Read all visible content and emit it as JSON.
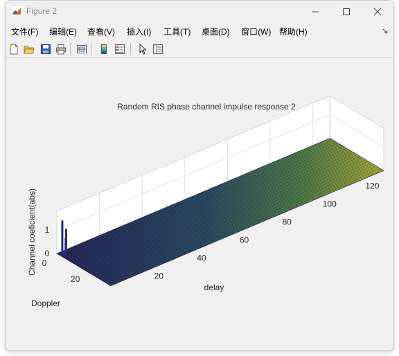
{
  "window": {
    "title": "Figure 2"
  },
  "menu": {
    "items": [
      {
        "label": "文件(F)"
      },
      {
        "label": "编辑(E)"
      },
      {
        "label": "查看(V)"
      },
      {
        "label": "插入(I)"
      },
      {
        "label": "工具(T)"
      },
      {
        "label": "桌面(D)"
      },
      {
        "label": "窗口(W)"
      },
      {
        "label": "帮助(H)"
      }
    ],
    "dock_arrow": "↘"
  },
  "toolbar": {
    "buttons": [
      "new-figure-icon",
      "open-file-icon",
      "save-icon",
      "print-icon",
      "link-plot-icon",
      "insert-colorbar-icon",
      "insert-legend-icon",
      "edit-plot-pointer-icon",
      "property-inspector-icon"
    ]
  },
  "chart_data": {
    "type": "surface3d",
    "title": "Random RIS phase channel impulse response 2",
    "xlabel": "delay",
    "ylabel": "Doppler",
    "zlabel": "Channel coeficient(abs)",
    "x_ticks": [
      "20",
      "40",
      "60",
      "80",
      "100",
      "120"
    ],
    "y_ticks": [
      "20"
    ],
    "z_ticks": [
      "0",
      "1"
    ],
    "x_tick_values": [
      20,
      40,
      60,
      80,
      100,
      120
    ],
    "y_tick_values": [
      20
    ],
    "z_tick_values": [
      0,
      1
    ],
    "xlim": [
      0,
      128
    ],
    "ylim": [
      0,
      32
    ],
    "zlim": [
      0,
      1.8
    ],
    "grid": true,
    "colormap": "parula-like (dark blue to yellow-green)",
    "peaks": [
      {
        "delay": 1,
        "doppler": 2,
        "value": 1.45
      },
      {
        "delay": 1,
        "doppler": 4,
        "value": 0.8
      },
      {
        "delay": 2,
        "doppler": 3,
        "value": 1.1
      }
    ],
    "colors": {
      "surface_low": "#2a2f6e",
      "surface_high": "#c8c83a",
      "peak": "#2b2f8f"
    }
  }
}
